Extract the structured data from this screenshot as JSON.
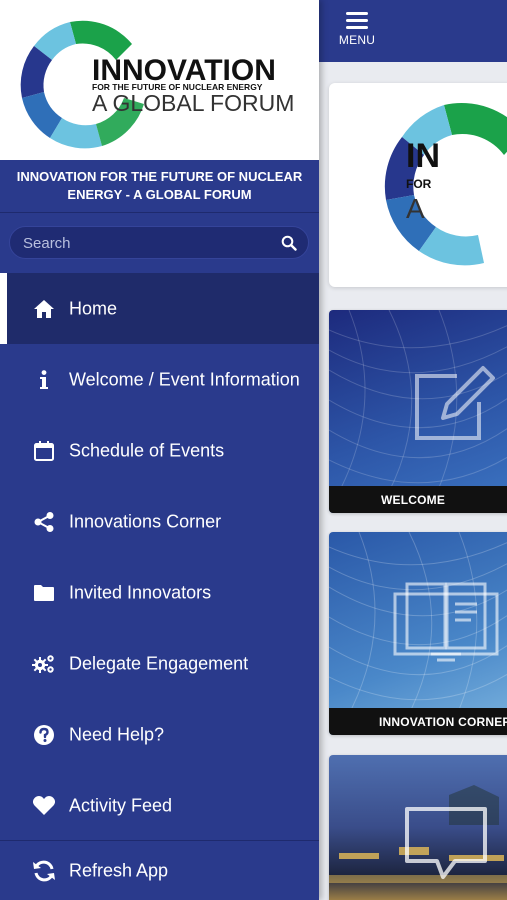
{
  "header": {
    "menu_label": "MENU"
  },
  "logo": {
    "line1": "INNOVATION",
    "line2": "FOR THE FUTURE OF NUCLEAR ENERGY",
    "line3": "A GLOBAL FORUM",
    "colors": {
      "green": "#1ba24a",
      "light_blue": "#6cc3e0",
      "blue": "#2f6fb8",
      "navy": "#27378d"
    }
  },
  "drawer": {
    "title": "INNOVATION FOR THE FUTURE OF NUCLEAR ENERGY - A GLOBAL FORUM",
    "search_placeholder": "Search",
    "items": [
      {
        "label": "Home",
        "icon": "home-icon",
        "active": true
      },
      {
        "label": "Welcome / Event Information",
        "icon": "info-icon",
        "active": false
      },
      {
        "label": "Schedule of Events",
        "icon": "calendar-icon",
        "active": false
      },
      {
        "label": "Innovations Corner",
        "icon": "share-icon",
        "active": false
      },
      {
        "label": "Invited Innovators",
        "icon": "folder-icon",
        "active": false
      },
      {
        "label": "Delegate Engagement",
        "icon": "gears-icon",
        "active": false
      },
      {
        "label": "Need Help?",
        "icon": "question-circle-icon",
        "active": false
      },
      {
        "label": "Activity Feed",
        "icon": "heart-icon",
        "active": false
      }
    ],
    "refresh_label": "Refresh App"
  },
  "tiles": [
    {
      "caption": "WELCOME",
      "icon": "edit-icon"
    },
    {
      "caption": "INNOVATION CORNER",
      "icon": "book-icon"
    },
    {
      "caption": "",
      "icon": "chat-bubble-icon"
    }
  ],
  "colors": {
    "primary": "#2a3a8c",
    "active_row": "#1f2b6a",
    "search_bg": "#1f2b73"
  }
}
